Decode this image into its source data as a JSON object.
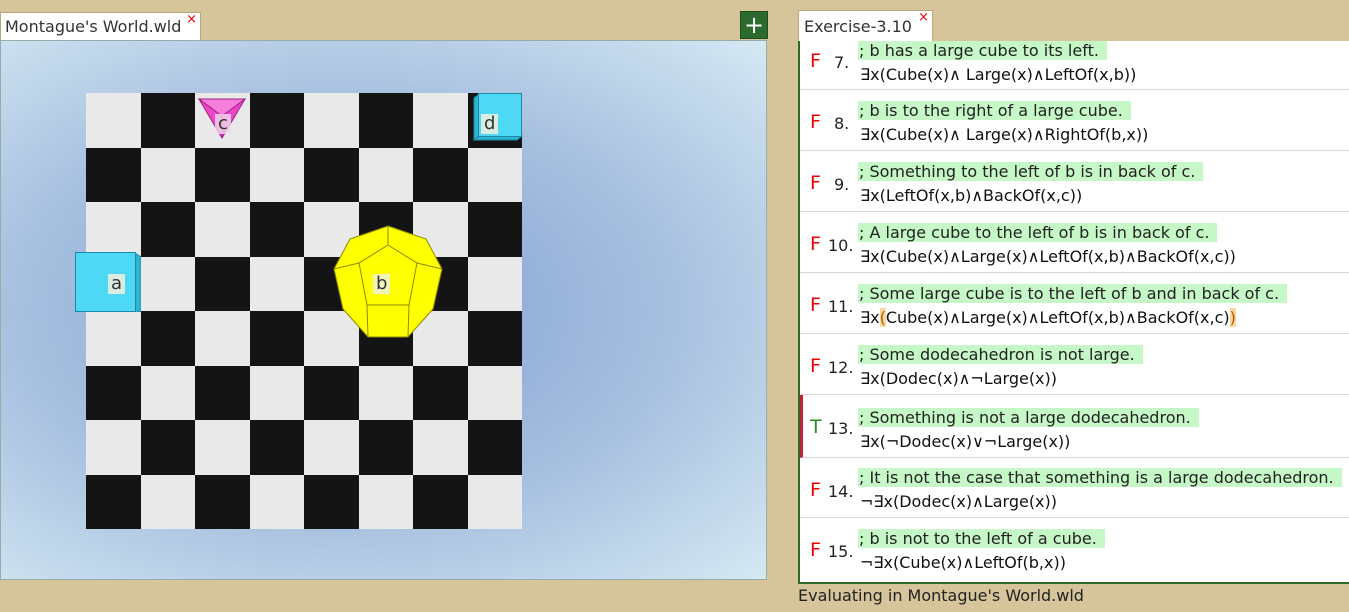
{
  "world_tab": {
    "label": "Montague's World.wld",
    "close_glyph": "×"
  },
  "add_button": {
    "label": "+"
  },
  "exercise_tab": {
    "label": "Exercise-3.10",
    "close_glyph": "×"
  },
  "world": {
    "board": {
      "rows": 8,
      "cols": 8
    },
    "objects": [
      {
        "label": "a",
        "shape": "cube",
        "size": "small",
        "color": "#4fd8f5"
      },
      {
        "label": "b",
        "shape": "dodecahedron",
        "size": "large",
        "color": "#ffff00"
      },
      {
        "label": "c",
        "shape": "tetrahedron",
        "size": "small",
        "color": "#ee44cc"
      },
      {
        "label": "d",
        "shape": "cube",
        "size": "small",
        "color": "#4fd8f5"
      }
    ]
  },
  "sentences": [
    {
      "truth": "F",
      "number": "7.",
      "comment": "; b has a large cube to its left.",
      "formula": "∃x(Cube(x)∧ Large(x)∧LeftOf(x,b))"
    },
    {
      "truth": "F",
      "number": "8.",
      "comment": "; b is to the right of a large cube.",
      "formula": "∃x(Cube(x)∧ Large(x)∧RightOf(b,x))"
    },
    {
      "truth": "F",
      "number": "9.",
      "comment": "; Something to the left of b is in back of c.",
      "formula": "∃x(LeftOf(x,b)∧BackOf(x,c))"
    },
    {
      "truth": "F",
      "number": "10.",
      "comment": "; A large cube to the left of b is in back of c.",
      "formula": "∃x(Cube(x)∧Large(x)∧LeftOf(x,b)∧BackOf(x,c))"
    },
    {
      "truth": "F",
      "number": "11.",
      "comment": "; Some large cube is to the left of b and in back of c.",
      "formula_prefix": "∃x",
      "formula_open": "(",
      "formula_body": "Cube(x)∧Large(x)∧LeftOf(x,b)∧BackOf(x,c)",
      "formula_close": ")"
    },
    {
      "truth": "F",
      "number": "12.",
      "comment": "; Some dodecahedron is not large.",
      "formula": "∃x(Dodec(x)∧¬Large(x))"
    },
    {
      "truth": "T",
      "number": "13.",
      "comment": "; Something is not a large dodecahedron.",
      "formula": "∃x(¬Dodec(x)∨¬Large(x))"
    },
    {
      "truth": "F",
      "number": "14.",
      "comment": "; It is not the case that something is a large dodecahedron.",
      "formula": "¬∃x(Dodec(x)∧Large(x))"
    },
    {
      "truth": "F",
      "number": "15.",
      "comment": "; b is not to the left of a cube.",
      "formula": "¬∃x(Cube(x)∧LeftOf(b,x))"
    }
  ],
  "status": "Evaluating in Montague's World.wld"
}
